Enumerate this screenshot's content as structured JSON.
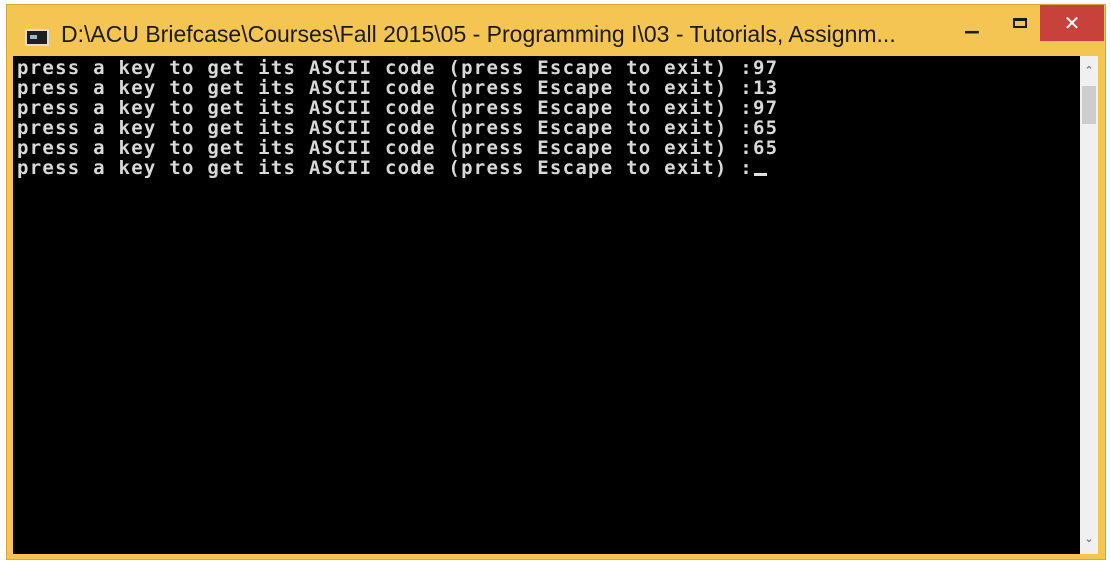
{
  "window": {
    "title": "D:\\ACU Briefcase\\Courses\\Fall 2015\\05 - Programming I\\03 - Tutorials, Assignm...",
    "minimize_glyph": "−",
    "close_glyph": "✕",
    "icon": "console-window-icon"
  },
  "console": {
    "lines": [
      "press a key to get its ASCII code (press Escape to exit) :97",
      "press a key to get its ASCII code (press Escape to exit) :13",
      "press a key to get its ASCII code (press Escape to exit) :97",
      "press a key to get its ASCII code (press Escape to exit) :65",
      "press a key to get its ASCII code (press Escape to exit) :65"
    ],
    "prompt": "press a key to get its ASCII code (press Escape to exit) :"
  },
  "scrollbar": {
    "up_glyph": "⌃",
    "down_glyph": "⌄"
  },
  "colors": {
    "frame": "#f4c552",
    "console_bg": "#000000",
    "console_text": "#d9d9d9",
    "close_button": "#c7423a"
  }
}
